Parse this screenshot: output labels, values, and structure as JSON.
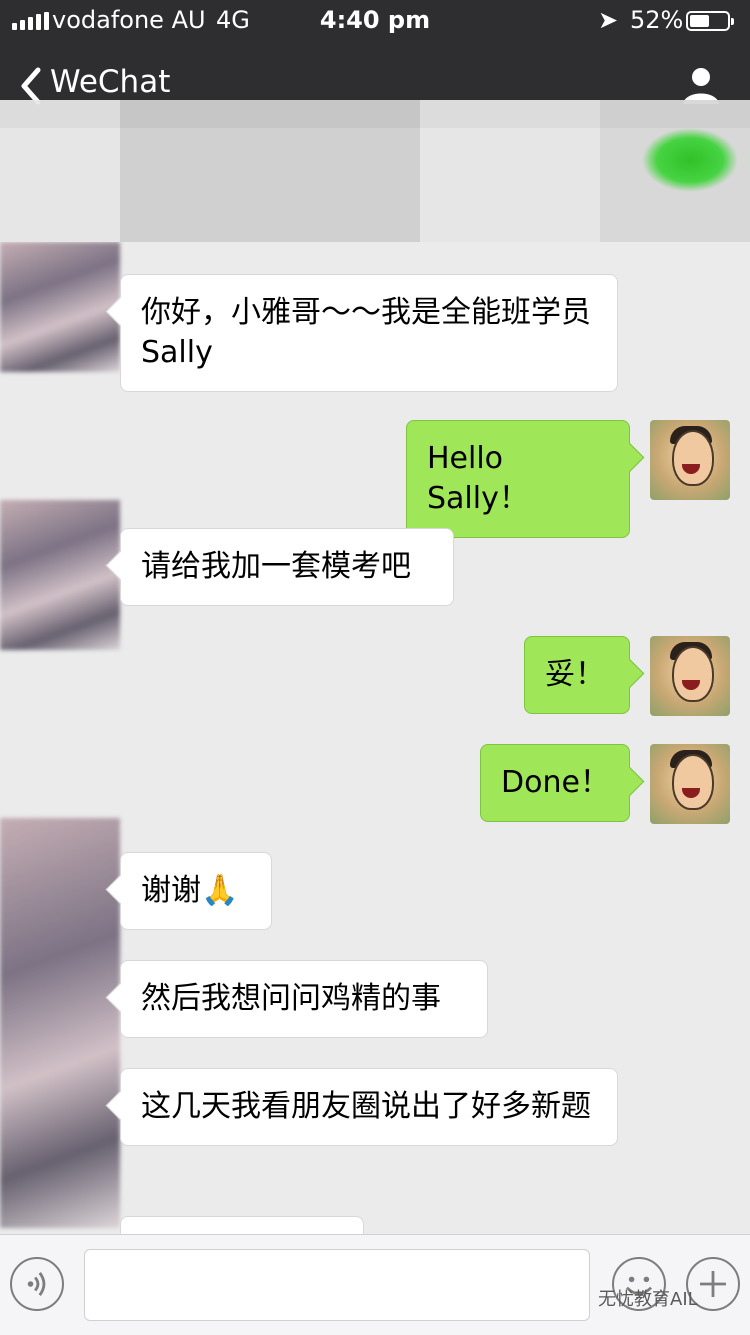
{
  "status_bar": {
    "carrier": "vodafone AU",
    "network": "4G",
    "time": "4:40 pm",
    "battery_percent": "52%",
    "battery_level": 0.52
  },
  "nav": {
    "back_label": "WeChat"
  },
  "messages": [
    {
      "side": "left",
      "text": "你好，小雅哥～～我是全能班学员Sally"
    },
    {
      "side": "right",
      "text": "Hello Sally！"
    },
    {
      "side": "left",
      "text": "请给我加一套模考吧"
    },
    {
      "side": "right",
      "text": "妥！"
    },
    {
      "side": "right",
      "text": "Done！"
    },
    {
      "side": "left",
      "text": "谢谢🙏"
    },
    {
      "side": "left",
      "text": "然后我想问问鸡精的事"
    },
    {
      "side": "left",
      "text": "这几天我看朋友圈说出了好多新题"
    }
  ],
  "watermark": "无忧教育AIL",
  "colors": {
    "nav_bg": "#2e2e31",
    "chat_bg": "#ebebeb",
    "bubble_right": "#9fe658",
    "bubble_left": "#ffffff",
    "accent_green": "#27c01e"
  }
}
